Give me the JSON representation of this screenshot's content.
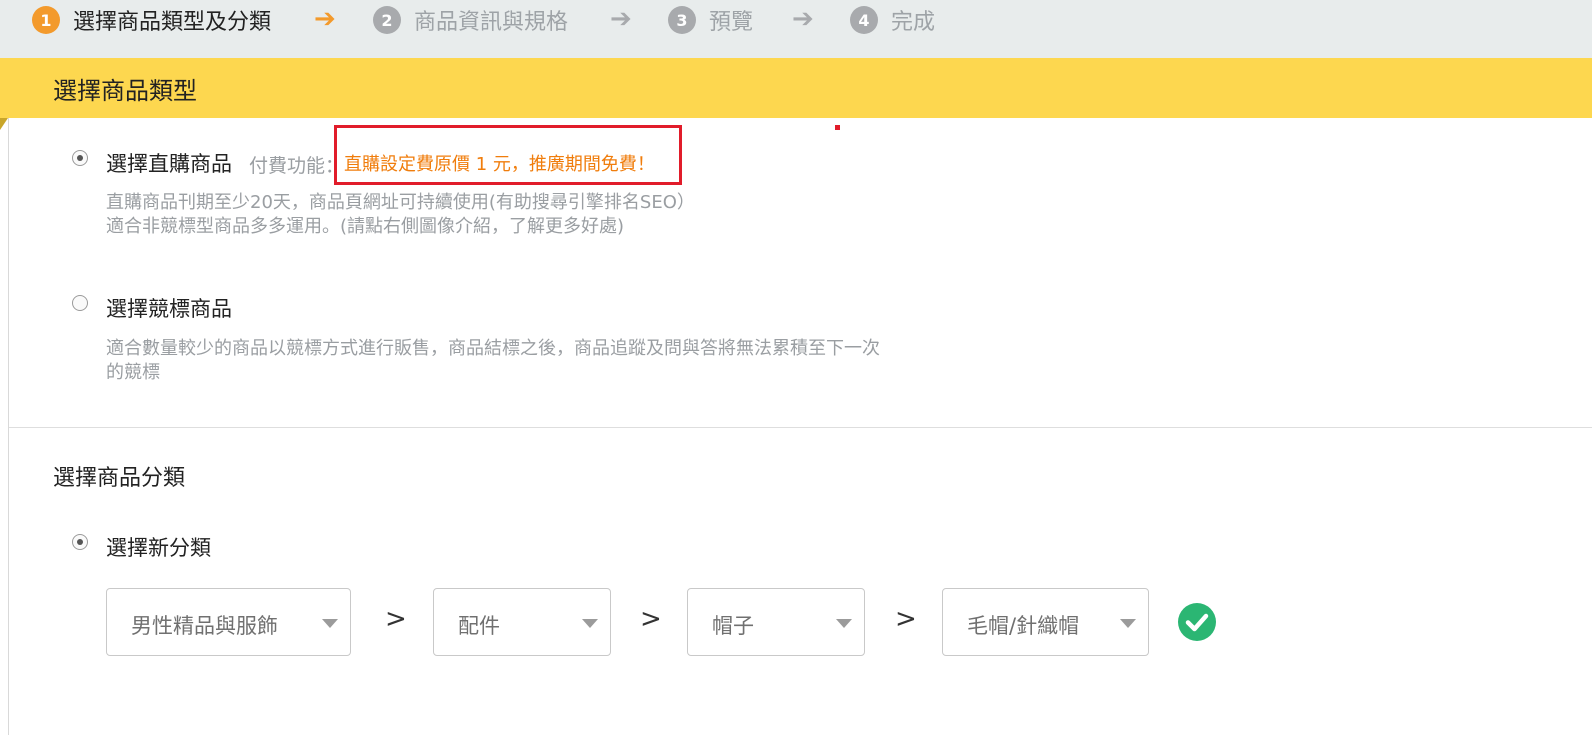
{
  "stepper": {
    "steps": [
      {
        "num": "1",
        "label": "選擇商品類型及分類",
        "state": "active"
      },
      {
        "num": "2",
        "label": "商品資訊與規格",
        "state": "inactive"
      },
      {
        "num": "3",
        "label": "預覽",
        "state": "inactive"
      },
      {
        "num": "4",
        "label": "完成",
        "state": "inactive"
      }
    ],
    "arrow": "➔"
  },
  "type_section": {
    "title": "選擇商品類型",
    "options": [
      {
        "title": "選擇直購商品",
        "selected": true,
        "paid_label": "付費功能：",
        "promo": "直購設定費原價 1 元，推廣期間免費！",
        "desc_line1": "直購商品刊期至少20天，商品頁網址可持續使用(有助搜尋引擎排名SEO）",
        "desc_line2": "適合非競標型商品多多運用。(請點右側圖像介紹，了解更多好處)"
      },
      {
        "title": "選擇競標商品",
        "selected": false,
        "desc_line1": "適合數量較少的商品以競標方式進行販售，商品結標之後，商品追蹤及問與答將無法累積至下一次",
        "desc_line2": "的競標"
      }
    ]
  },
  "category_section": {
    "title": "選擇商品分類",
    "option_label": "選擇新分類",
    "selects": [
      "男性精品與服飾",
      "配件",
      "帽子",
      "毛帽/針織帽"
    ],
    "separator": ">"
  },
  "colors": {
    "accent_orange": "#f39a2c",
    "header_yellow": "#fdd74f",
    "highlight_red": "#e11c2a",
    "promo_orange": "#f07d0c",
    "success_green": "#2bb673"
  }
}
